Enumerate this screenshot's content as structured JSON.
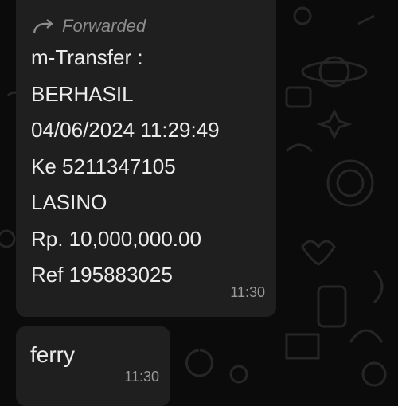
{
  "wallpaper": {
    "color": "#0b0b0b",
    "doodle_color": "#2a2a2a"
  },
  "message_1": {
    "forwarded_label": "Forwarded",
    "lines": [
      "m-Transfer :",
      "BERHASIL",
      "04/06/2024 11:29:49",
      "Ke 5211347105",
      "LASINO",
      "Rp. 10,000,000.00",
      "Ref 195883025"
    ],
    "time": "11:30"
  },
  "message_2": {
    "text": "ferry",
    "time": "11:30"
  },
  "colors": {
    "bubble": "#1f1f1f",
    "text": "#ececec",
    "meta": "#9a9a9a"
  }
}
